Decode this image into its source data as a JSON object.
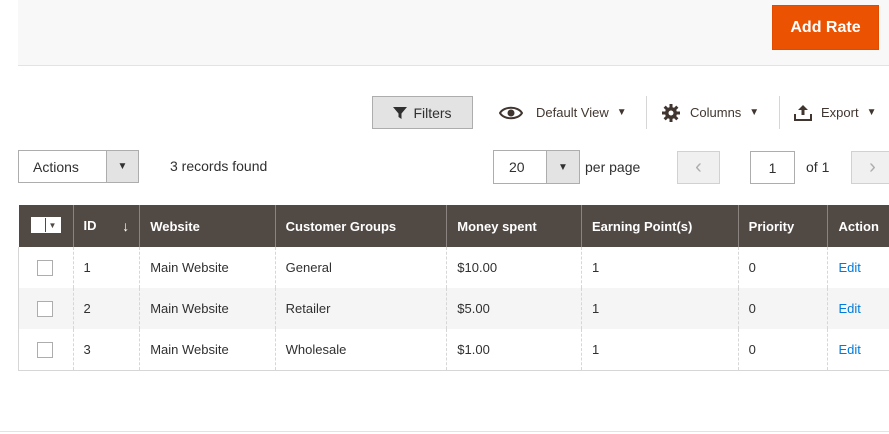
{
  "header": {
    "add_rate_label": "Add Rate"
  },
  "toolbar": {
    "filters_label": "Filters",
    "default_view_label": "Default View",
    "columns_label": "Columns",
    "export_label": "Export"
  },
  "controls": {
    "actions_label": "Actions",
    "records_found": "3 records found",
    "per_page_value": "20",
    "per_page_label": "per page",
    "current_page": "1",
    "of_pages": "of 1"
  },
  "grid": {
    "columns": [
      "ID",
      "Website",
      "Customer Groups",
      "Money spent",
      "Earning Point(s)",
      "Priority",
      "Action"
    ],
    "sort_indicator": "↓",
    "rows": [
      {
        "id": "1",
        "website": "Main Website",
        "group": "General",
        "money": "$10.00",
        "points": "1",
        "priority": "0",
        "action": "Edit"
      },
      {
        "id": "2",
        "website": "Main Website",
        "group": "Retailer",
        "money": "$5.00",
        "points": "1",
        "priority": "0",
        "action": "Edit"
      },
      {
        "id": "3",
        "website": "Main Website",
        "group": "Wholesale",
        "money": "$1.00",
        "points": "1",
        "priority": "0",
        "action": "Edit"
      }
    ]
  },
  "icons": {
    "filters": "funnel-icon",
    "default_view": "eye-icon",
    "columns": "gear-icon",
    "export": "upload-icon"
  },
  "colors": {
    "accent": "#eb5202",
    "grid_header": "#514943",
    "link": "#007bdb"
  }
}
